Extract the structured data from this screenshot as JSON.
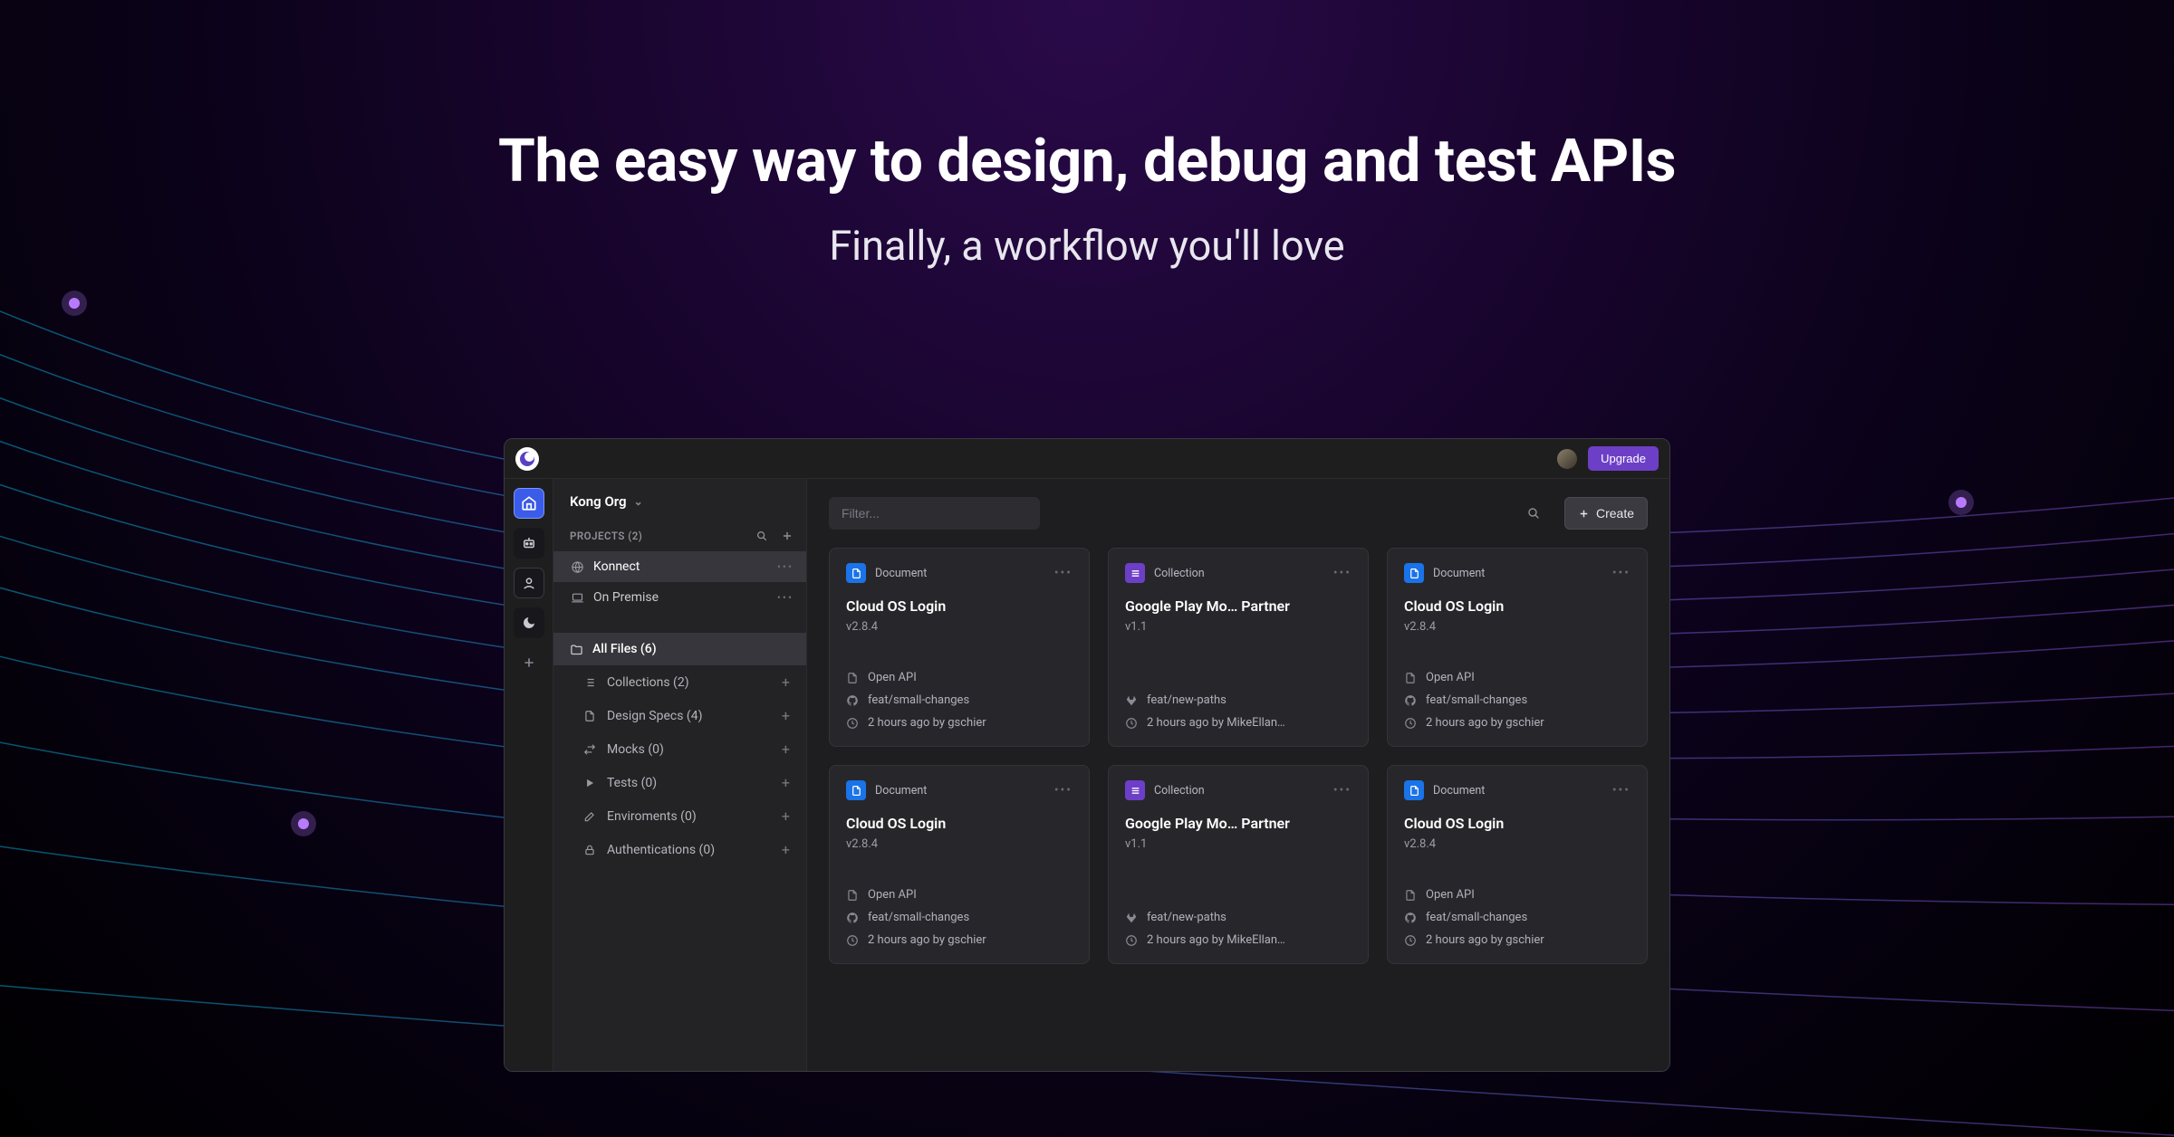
{
  "hero": {
    "title": "The easy way to design, debug and test APIs",
    "subtitle": "Finally, a workflow you'll love"
  },
  "titlebar": {
    "upgrade_label": "Upgrade"
  },
  "sidebar": {
    "org_name": "Kong Org",
    "projects_header": "PROJECTS (2)",
    "projects": [
      {
        "name": "Konnect",
        "icon": "globe",
        "active": true
      },
      {
        "name": "On Premise",
        "icon": "laptop",
        "active": false
      }
    ],
    "allfiles_label": "All Files (6)",
    "tree": [
      {
        "label": "Collections (2)",
        "icon": "list"
      },
      {
        "label": "Design Specs (4)",
        "icon": "file"
      },
      {
        "label": "Mocks (0)",
        "icon": "swap"
      },
      {
        "label": "Tests (0)",
        "icon": "play"
      },
      {
        "label": "Enviroments (0)",
        "icon": "edit"
      },
      {
        "label": "Authentications (0)",
        "icon": "lock"
      }
    ]
  },
  "toolbar": {
    "filter_placeholder": "Filter...",
    "create_label": "Create"
  },
  "cards": [
    {
      "type": "Document",
      "type_kind": "doc",
      "title": "Cloud OS Login",
      "version": "v2.8.4",
      "spec": "Open API",
      "branch": "feat/small-changes",
      "branch_icon": "github",
      "time": "2 hours ago by gschier"
    },
    {
      "type": "Collection",
      "type_kind": "coll",
      "title": "Google Play Mo… Partner",
      "version": "v1.1",
      "spec": "",
      "branch": "feat/new-paths",
      "branch_icon": "gitlab",
      "time": "2 hours ago by MikeEllan…"
    },
    {
      "type": "Document",
      "type_kind": "doc",
      "title": "Cloud OS Login",
      "version": "v2.8.4",
      "spec": "Open API",
      "branch": "feat/small-changes",
      "branch_icon": "github",
      "time": "2 hours ago by gschier"
    },
    {
      "type": "Document",
      "type_kind": "doc",
      "title": "Cloud OS Login",
      "version": "v2.8.4",
      "spec": "Open API",
      "branch": "feat/small-changes",
      "branch_icon": "github",
      "time": "2 hours ago by gschier"
    },
    {
      "type": "Collection",
      "type_kind": "coll",
      "title": "Google Play Mo… Partner",
      "version": "v1.1",
      "spec": "",
      "branch": "feat/new-paths",
      "branch_icon": "gitlab",
      "time": "2 hours ago by MikeEllan…"
    },
    {
      "type": "Document",
      "type_kind": "doc",
      "title": "Cloud OS Login",
      "version": "v2.8.4",
      "spec": "Open API",
      "branch": "feat/small-changes",
      "branch_icon": "github",
      "time": "2 hours ago by gschier"
    }
  ]
}
